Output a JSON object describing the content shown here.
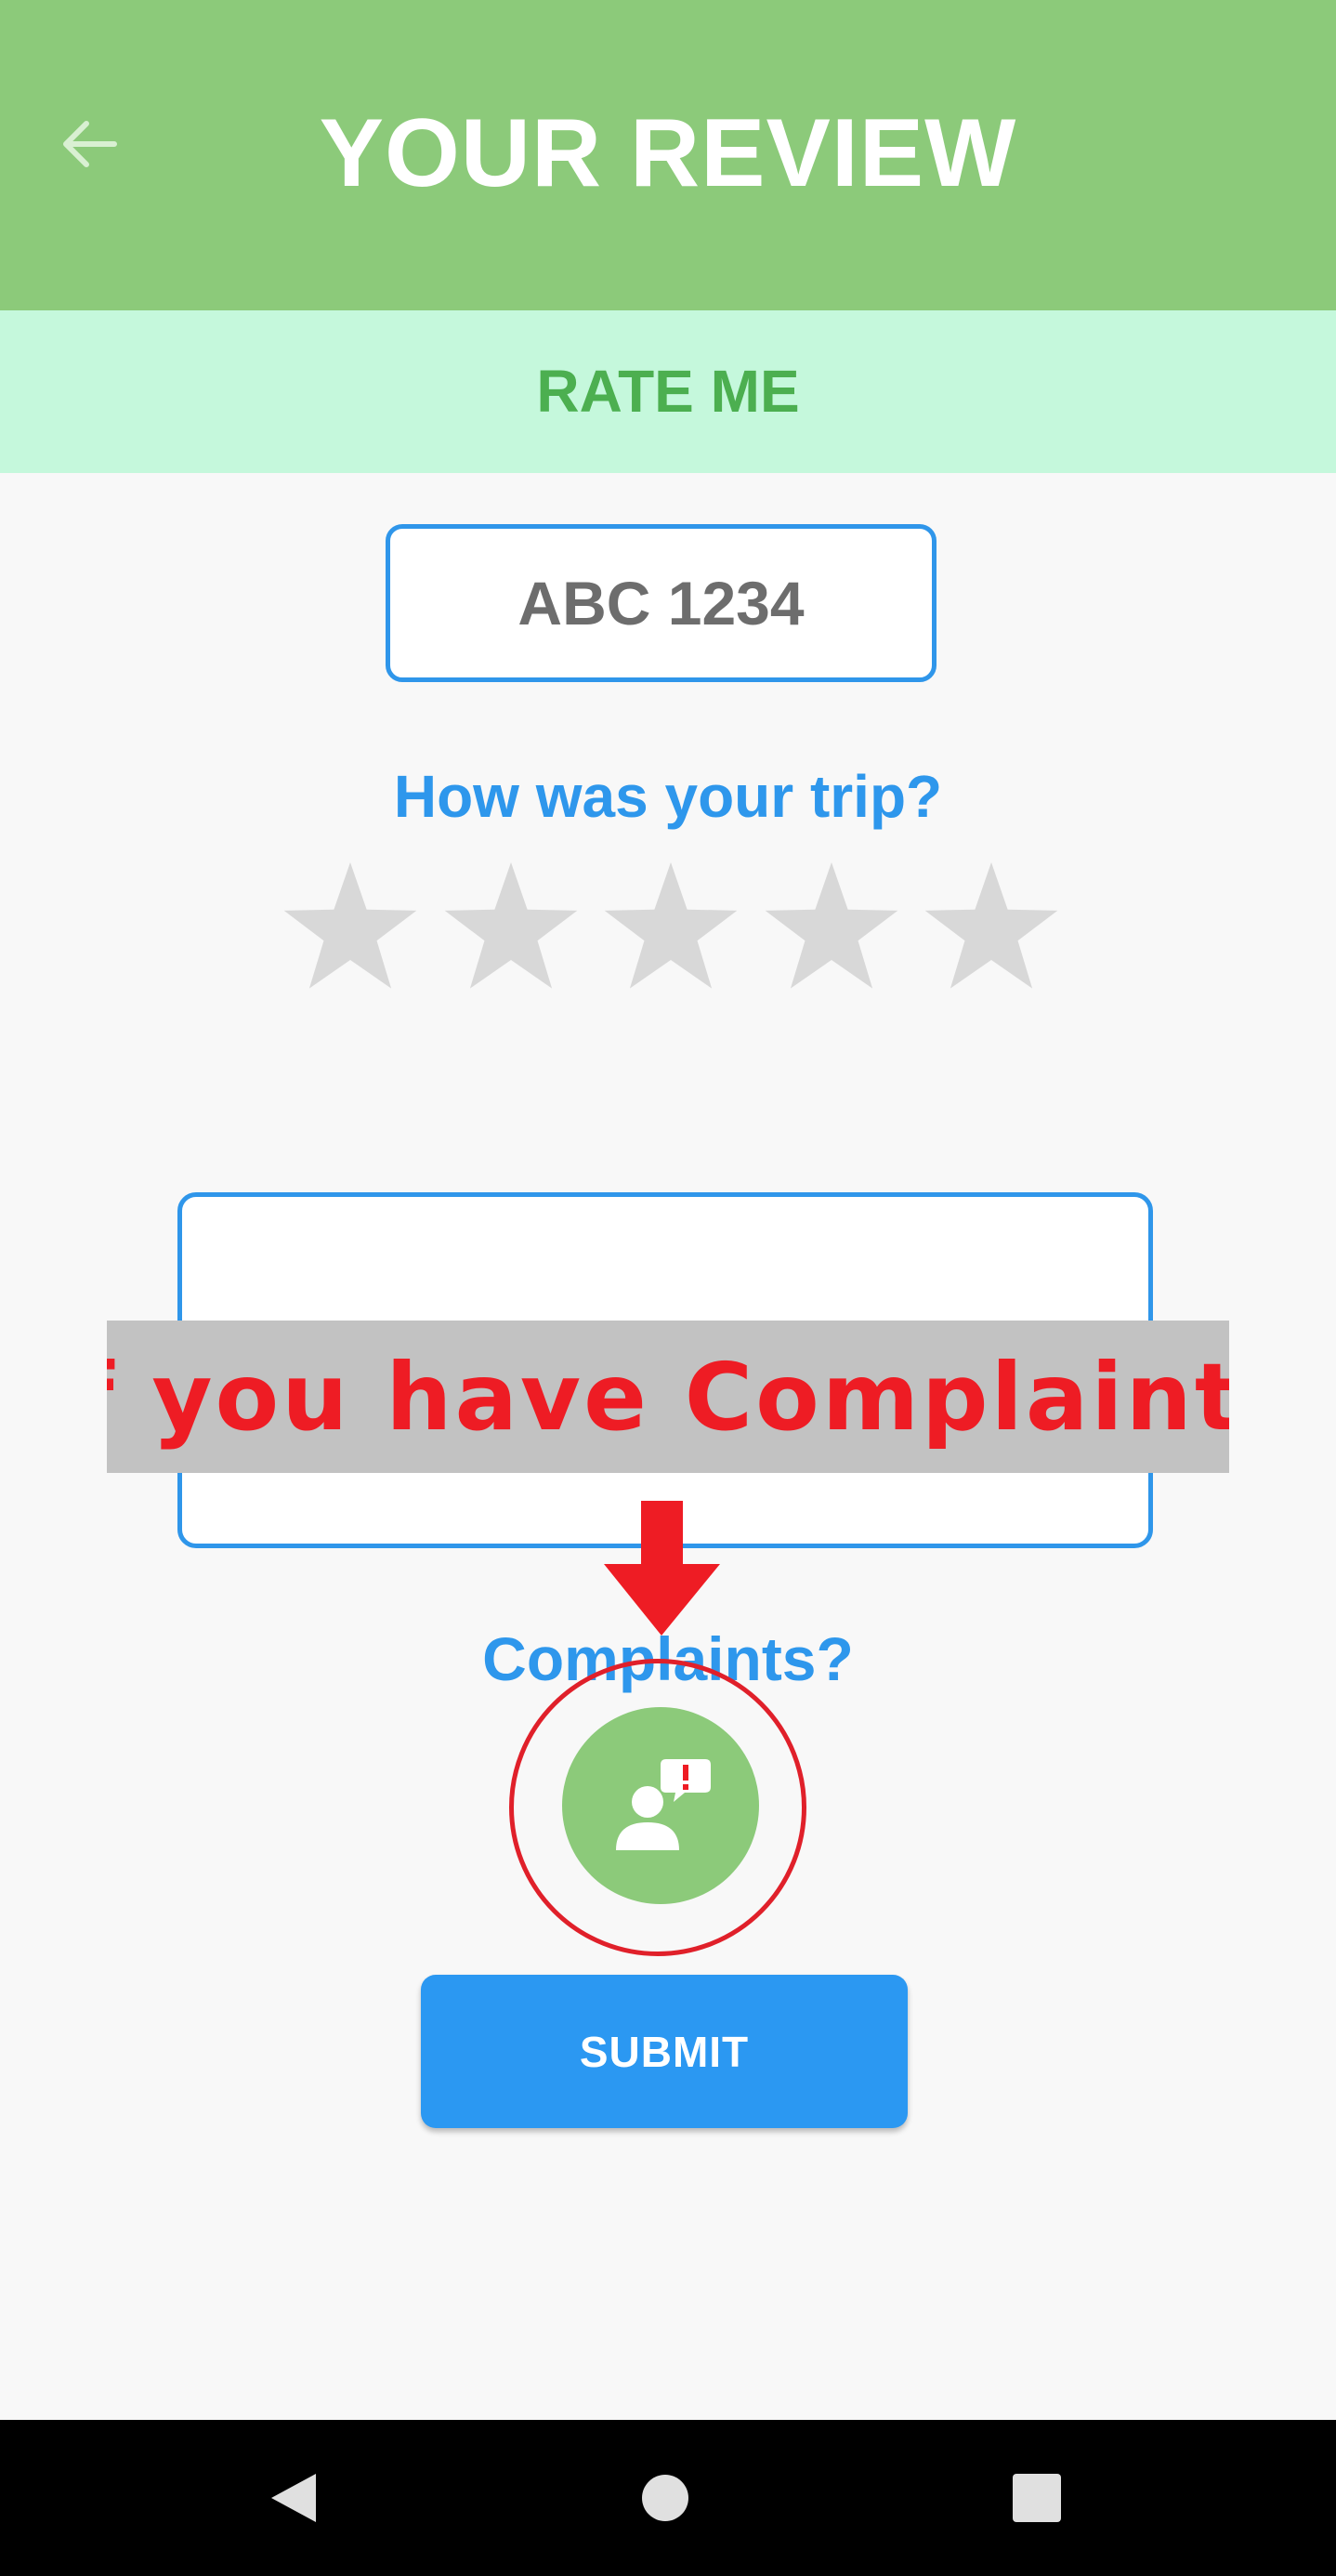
{
  "header": {
    "title": "YOUR REVIEW",
    "back_icon": "arrow-left-icon",
    "background_color": "#8cca7a"
  },
  "rate_band": {
    "label": "RATE ME",
    "background_color": "#c5f8dc",
    "text_color": "#4caf50"
  },
  "plate": {
    "value": "ABC 1234"
  },
  "rating": {
    "question": "How was your trip?",
    "max_stars": 5,
    "selected": 0,
    "star_icon": "star-icon",
    "empty_color": "#d8d8d8"
  },
  "comment": {
    "value": ""
  },
  "annotation": {
    "banner_text": "If you have Complaints",
    "arrow_icon": "arrow-down-icon",
    "highlight_color": "#e0202a"
  },
  "complaints": {
    "label": "Complaints?",
    "icon": "person-complaint-icon"
  },
  "submit": {
    "label": "SUBMIT",
    "color": "#2b98f2"
  },
  "nav": {
    "back_icon": "nav-back-icon",
    "home_icon": "nav-home-icon",
    "recents_icon": "nav-recents-icon"
  },
  "colors": {
    "accent_blue": "#2e97ec",
    "page_background": "#f8f8f8"
  }
}
